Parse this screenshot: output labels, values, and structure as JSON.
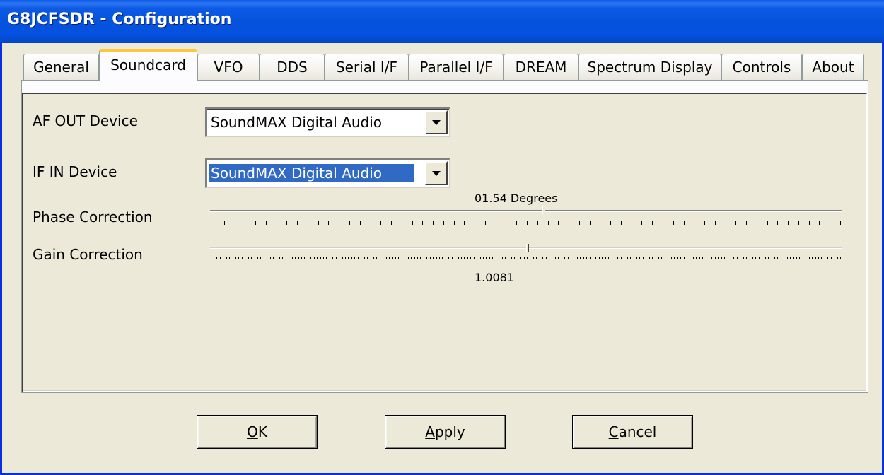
{
  "window": {
    "title": "G8JCFSDR - Configuration"
  },
  "tabs": [
    {
      "label": "General"
    },
    {
      "label": "Soundcard",
      "active": true
    },
    {
      "label": "VFO"
    },
    {
      "label": "DDS"
    },
    {
      "label": "Serial I/F"
    },
    {
      "label": "Parallel I/F"
    },
    {
      "label": "DREAM"
    },
    {
      "label": "Spectrum Display"
    },
    {
      "label": "Controls"
    },
    {
      "label": "About"
    }
  ],
  "soundcard": {
    "af_out_label": "AF OUT Device",
    "af_out_value": "SoundMAX Digital Audio",
    "if_in_label": "IF IN Device",
    "if_in_value": "SoundMAX Digital Audio",
    "phase_label": "Phase Correction",
    "phase_value_text": "01.54 Degrees",
    "phase_position": 0.53,
    "gain_label": "Gain Correction",
    "gain_value_text": "1.0081",
    "gain_position": 0.505
  },
  "buttons": {
    "ok_underline": "O",
    "ok_rest": "K",
    "apply_underline": "A",
    "apply_rest": "pply",
    "cancel_underline": "C",
    "cancel_rest": "ancel"
  },
  "colors": {
    "title_bar": "#0453dd",
    "window_border": "#0831d9",
    "face": "#ece9d8",
    "selection": "#316ac5",
    "active_tab_accent": "#ffc83c"
  }
}
